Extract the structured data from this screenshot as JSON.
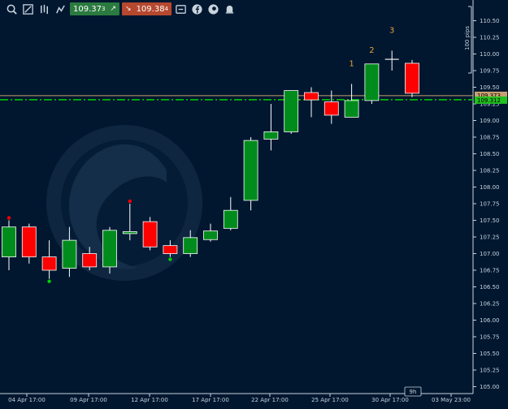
{
  "toolbar": {
    "icons": [
      "zoom-in-icon",
      "zoom-out-icon",
      "bar-chart-icon",
      "chart-settings-icon"
    ],
    "buy_price": "109.37",
    "buy_price_sup": "3",
    "sell_price": "109.38",
    "sell_price_sup": "4",
    "extra_icons": [
      "trade-icon",
      "facebook-icon",
      "share-icon",
      "bell-icon"
    ]
  },
  "indicator_labels": [
    "1",
    "2",
    "3"
  ],
  "measure_label": "100 pips",
  "time_tag": "9h",
  "price_tags": {
    "current": "109.312",
    "other": "109.373"
  },
  "colors": {
    "bull": "#008c1c",
    "bear": "#ff0000",
    "background": "#00172f",
    "grid_axis": "#c8d3de",
    "horizontal_line": "#00d000",
    "resistance_line": "#c8a070",
    "indicator_numbers": "#e6a23c"
  },
  "chart_data": {
    "type": "candlestick",
    "y_axis": {
      "ticks": [
        "110.50",
        "110.25",
        "110.00",
        "109.75",
        "109.50",
        "109.25",
        "109.00",
        "108.75",
        "108.50",
        "108.25",
        "108.00",
        "107.75",
        "107.50",
        "107.25",
        "107.00",
        "106.75",
        "106.50",
        "106.25",
        "106.00",
        "105.75",
        "105.50",
        "105.25",
        "105.00"
      ]
    },
    "x_axis": {
      "ticks": [
        "04 Apr 17:00",
        "09 Apr 17:00",
        "12 Apr 17:00",
        "17 Apr 17:00",
        "22 Apr 17:00",
        "25 Apr 17:00",
        "30 Apr 17:00",
        "03 May 23:00"
      ]
    },
    "candles": [
      {
        "open": 106.95,
        "close": 107.4,
        "high": 107.5,
        "low": 106.75
      },
      {
        "open": 107.4,
        "close": 106.95,
        "high": 107.45,
        "low": 106.85
      },
      {
        "open": 106.95,
        "close": 106.75,
        "high": 107.2,
        "low": 106.62
      },
      {
        "open": 106.78,
        "close": 107.2,
        "high": 107.4,
        "low": 106.65
      },
      {
        "open": 107.0,
        "close": 106.8,
        "high": 107.1,
        "low": 106.75
      },
      {
        "open": 106.8,
        "close": 107.35,
        "high": 107.4,
        "low": 106.7
      },
      {
        "open": 107.3,
        "close": 107.33,
        "high": 107.75,
        "low": 107.2
      },
      {
        "open": 107.48,
        "close": 107.1,
        "high": 107.55,
        "low": 107.05
      },
      {
        "open": 107.12,
        "close": 107.0,
        "high": 107.2,
        "low": 106.95
      },
      {
        "open": 107.0,
        "close": 107.24,
        "high": 107.35,
        "low": 106.95
      },
      {
        "open": 107.21,
        "close": 107.34,
        "high": 107.45,
        "low": 107.18
      },
      {
        "open": 107.38,
        "close": 107.65,
        "high": 107.85,
        "low": 107.35
      },
      {
        "open": 107.8,
        "close": 108.7,
        "high": 108.75,
        "low": 107.65
      },
      {
        "open": 108.72,
        "close": 108.83,
        "high": 109.25,
        "low": 108.55
      },
      {
        "open": 108.83,
        "close": 109.45,
        "high": 109.45,
        "low": 108.8
      },
      {
        "open": 109.42,
        "close": 109.31,
        "high": 109.5,
        "low": 109.05
      },
      {
        "open": 109.28,
        "close": 109.08,
        "high": 109.45,
        "low": 108.95
      },
      {
        "open": 109.05,
        "close": 109.3,
        "high": 109.55,
        "low": 109.05
      },
      {
        "open": 109.3,
        "close": 109.85,
        "high": 109.85,
        "low": 109.25
      },
      {
        "open": 109.92,
        "close": 109.92,
        "high": 110.05,
        "low": 109.75
      },
      {
        "open": 109.86,
        "close": 109.41,
        "high": 109.91,
        "low": 109.35
      }
    ],
    "current_price": 109.312,
    "resistance_price": 109.373,
    "markers": [
      {
        "candle": 0,
        "type": "high",
        "color": "#ff0000"
      },
      {
        "candle": 6,
        "type": "high",
        "color": "#ff0000"
      },
      {
        "candle": 2,
        "type": "low",
        "color": "#00d000"
      },
      {
        "candle": 8,
        "type": "low",
        "color": "#00d000"
      }
    ]
  }
}
